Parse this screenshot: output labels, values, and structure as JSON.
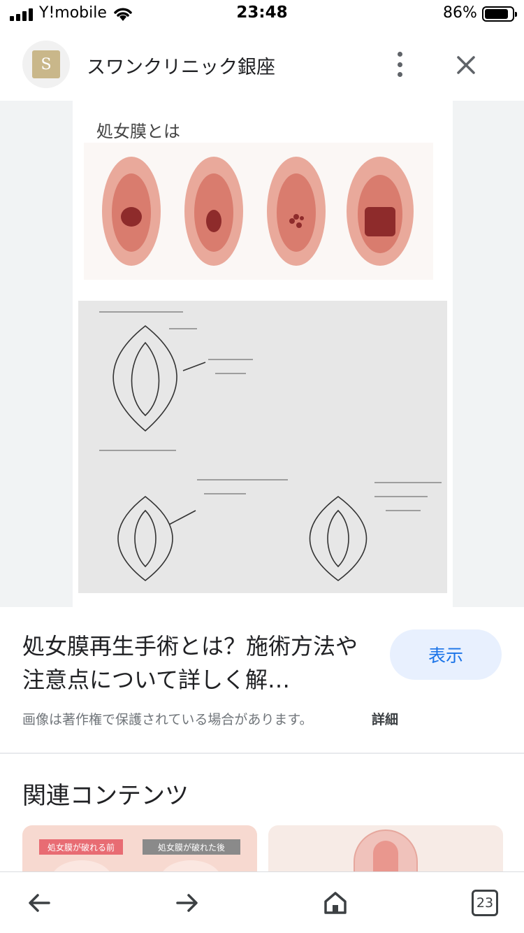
{
  "status_bar": {
    "carrier": "Y!mobile",
    "time": "23:48",
    "battery_percent": "86%",
    "battery_level": 0.86
  },
  "header": {
    "site_name": "スワンクリニック銀座",
    "favicon_letter": "S"
  },
  "image": {
    "title_text": "処女膜とは"
  },
  "result": {
    "title": "処女膜再生手術とは？施術方法や注意点について詳しく解…",
    "view_button": "表示",
    "copyright_notice": "画像は著作権で保護されている場合があります。",
    "details_link": "詳細"
  },
  "related": {
    "heading": "関連コンテンツ",
    "card1_tag_before": "処女膜が破れる前",
    "card1_tag_after": "処女膜が破れた後"
  },
  "bottom_nav": {
    "tabs_count": "23"
  },
  "colors": {
    "accent_blue": "#1a73e8",
    "view_button_bg": "#e8f0fe",
    "icon_gray": "#5f6368"
  },
  "icons": [
    "signal-icon",
    "wifi-icon",
    "battery-icon",
    "more-vert-icon",
    "close-icon",
    "back-arrow-icon",
    "forward-arrow-icon",
    "home-icon",
    "tabs-icon"
  ]
}
